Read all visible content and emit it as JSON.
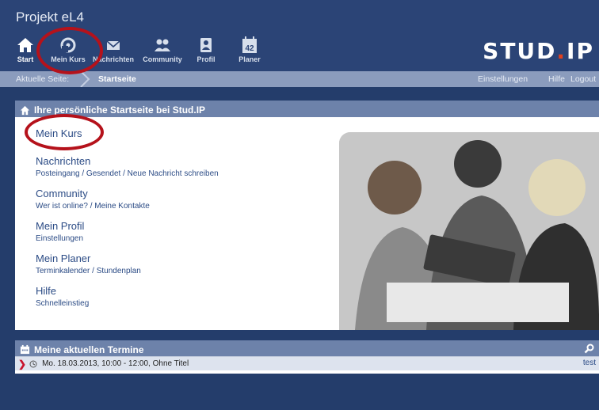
{
  "app": {
    "title": "Projekt eL4",
    "logo_main": "STUD",
    "logo_dot": ".",
    "logo_tail": "IP"
  },
  "nav": [
    {
      "label": "Start",
      "icon": "home-icon"
    },
    {
      "label": "Mein Kurs",
      "icon": "course-icon"
    },
    {
      "label": "Nachrichten",
      "icon": "mail-icon"
    },
    {
      "label": "Community",
      "icon": "community-icon"
    },
    {
      "label": "Profil",
      "icon": "profile-icon"
    },
    {
      "label": "Planer",
      "icon": "calendar-icon",
      "badge": "42"
    }
  ],
  "breadcrumb": {
    "current_page_label": "Aktuelle Seite:",
    "page": "Startseite"
  },
  "top_links": {
    "settings": "Einstellungen",
    "help": "Hilfe",
    "logout": "Logout"
  },
  "start_panel": {
    "title": "Ihre persönliche Startseite bei Stud.IP",
    "links": [
      {
        "title": "Mein Kurs",
        "sub": ""
      },
      {
        "title": "Nachrichten",
        "sub": "Posteingang / Gesendet / Neue Nachricht schreiben"
      },
      {
        "title": "Community",
        "sub": "Wer ist online? / Meine Kontakte"
      },
      {
        "title": "Mein Profil",
        "sub": "Einstellungen"
      },
      {
        "title": "Mein Planer",
        "sub": "Terminkalender / Stundenplan"
      },
      {
        "title": "Hilfe",
        "sub": "Schnelleinstieg"
      }
    ]
  },
  "termine_panel": {
    "title": "Meine aktuellen Termine",
    "rows": [
      {
        "text": "Mo. 18.03.2013, 10:00 - 12:00, Ohne Titel",
        "right": "test"
      }
    ]
  },
  "colors": {
    "header": "#2b4476",
    "page_bg": "#243d6b",
    "panel_head": "#6d82aa",
    "accent_red": "#b5121b",
    "logo_dot": "#e2401d"
  }
}
